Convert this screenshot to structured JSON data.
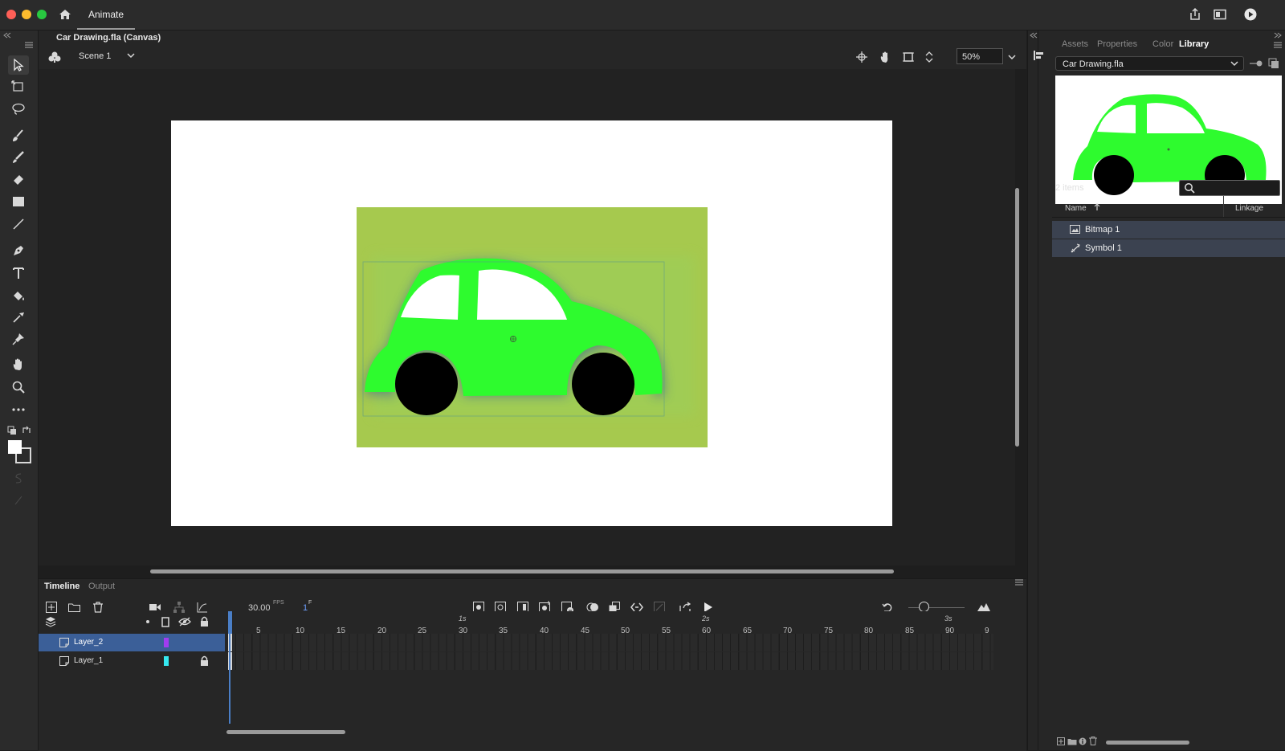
{
  "window": {
    "app_title": "Animate"
  },
  "document": {
    "title": "Car Drawing.fla (Canvas)",
    "scene": "Scene 1",
    "zoom": "50%"
  },
  "right_panel": {
    "tabs": [
      "Assets",
      "Properties",
      "Color",
      "Library"
    ],
    "active_tab": "Library",
    "library_file": "Car Drawing.fla",
    "item_count": "2 items",
    "columns": {
      "name": "Name",
      "linkage": "Linkage"
    },
    "items": [
      {
        "name": "Bitmap 1",
        "icon": "bitmap-icon"
      },
      {
        "name": "Symbol 1",
        "icon": "symbol-icon"
      }
    ]
  },
  "timeline": {
    "tabs": [
      "Timeline",
      "Output"
    ],
    "active_tab": "Timeline",
    "fps": "30.00",
    "fps_unit": "FPS",
    "current_frame": "1",
    "frame_unit": "F",
    "seconds_markers": [
      "1s",
      "2s",
      "3s"
    ],
    "frame_numbers": [
      "5",
      "10",
      "15",
      "20",
      "25",
      "30",
      "35",
      "40",
      "45",
      "50",
      "55",
      "60",
      "65",
      "70",
      "75",
      "80",
      "85",
      "90",
      "9"
    ],
    "layers": [
      {
        "name": "Layer_2",
        "color": "#a23cf0",
        "selected": true,
        "locked": false
      },
      {
        "name": "Layer_1",
        "color": "#35e8f0",
        "selected": false,
        "locked": true
      }
    ]
  },
  "colors": {
    "accent_blue": "#4a7ec6",
    "car_green": "#2efb2e",
    "bitmap_bg": "#a6c94e"
  }
}
